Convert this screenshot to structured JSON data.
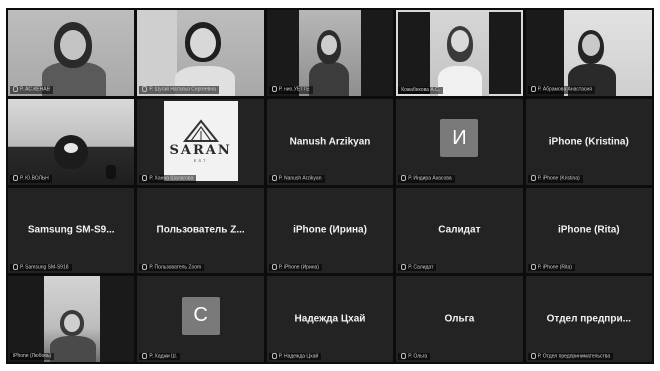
{
  "participants": [
    {
      "label": "",
      "tag": "Р. АС.КЕНАВ",
      "kind": "video"
    },
    {
      "label": "",
      "tag": "Р. Шугай Наталья Сергеевна",
      "kind": "video"
    },
    {
      "label": "",
      "tag": "Р. нио.УЕТТЕ",
      "kind": "video"
    },
    {
      "label": "",
      "tag": "Кожабекова А.С.",
      "kind": "video",
      "active": true
    },
    {
      "label": "",
      "tag": "Р. Абрамова Анастасия",
      "kind": "video"
    },
    {
      "label": "",
      "tag": "Р. Ю.ВОЛЬН",
      "kind": "video"
    },
    {
      "label": "",
      "tag": "Р. Ханна Шалагова",
      "kind": "logo",
      "logo_text": "SARAN",
      "logo_sub": "EST"
    },
    {
      "label": "Nanush Arzikyan",
      "tag": "Р. Nanush Arzikyan",
      "kind": "name"
    },
    {
      "label": "",
      "tag": "Р. Индира Ахасова",
      "kind": "avatar",
      "initial": "И"
    },
    {
      "label": "iPhone (Kristina)",
      "tag": "Р. iPhone (Kristina)",
      "kind": "name"
    },
    {
      "label": "Samsung SM-S9...",
      "tag": "Р. Samsung SM-S918",
      "kind": "name"
    },
    {
      "label": "Пользователь Z...",
      "tag": "Р. Пользователь Zoom",
      "kind": "name"
    },
    {
      "label": "iPhone (Ирина)",
      "tag": "Р. iPhone (Ирина)",
      "kind": "name"
    },
    {
      "label": "Салидат",
      "tag": "Р. Салидат",
      "kind": "name"
    },
    {
      "label": "iPhone (Rita)",
      "tag": "Р. iPhone (Rita)",
      "kind": "name"
    },
    {
      "label": "",
      "tag": "iPhone (Любовь)",
      "kind": "video-inset"
    },
    {
      "label": "",
      "tag": "Р. Хаджи Ш.",
      "kind": "avatar",
      "initial": "С"
    },
    {
      "label": "Надежда Цхай",
      "tag": "Р. Надежда Цхай",
      "kind": "name"
    },
    {
      "label": "Ольга",
      "tag": "Р. Ольга",
      "kind": "name"
    },
    {
      "label": "Отдел предпри...",
      "tag": "Р. Отдел предпринимательства",
      "kind": "name"
    }
  ]
}
